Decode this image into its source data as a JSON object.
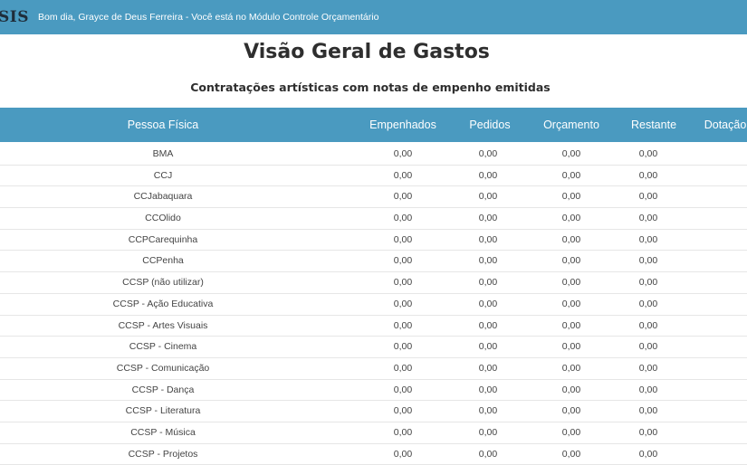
{
  "header": {
    "logo": "SIS",
    "greeting": "Bom dia, Grayce de Deus Ferreira - Você está no Módulo Controle Orçamentário"
  },
  "page": {
    "title": "Visão Geral de Gastos",
    "subtitle": "Contratações artísticas com notas de empenho emitidas"
  },
  "table": {
    "columns": [
      "Pessoa Física",
      "Empenhados",
      "Pedidos",
      "Orçamento",
      "Restante",
      "Dotação"
    ],
    "rows": [
      {
        "name": "BMA",
        "empenhados": "0,00",
        "pedidos": "0,00",
        "orcamento": "0,00",
        "restante": "0,00"
      },
      {
        "name": "CCJ",
        "empenhados": "0,00",
        "pedidos": "0,00",
        "orcamento": "0,00",
        "restante": "0,00"
      },
      {
        "name": "CCJabaquara",
        "empenhados": "0,00",
        "pedidos": "0,00",
        "orcamento": "0,00",
        "restante": "0,00"
      },
      {
        "name": "CCOlido",
        "empenhados": "0,00",
        "pedidos": "0,00",
        "orcamento": "0,00",
        "restante": "0,00"
      },
      {
        "name": "CCPCarequinha",
        "empenhados": "0,00",
        "pedidos": "0,00",
        "orcamento": "0,00",
        "restante": "0,00"
      },
      {
        "name": "CCPenha",
        "empenhados": "0,00",
        "pedidos": "0,00",
        "orcamento": "0,00",
        "restante": "0,00"
      },
      {
        "name": "CCSP (não utilizar)",
        "empenhados": "0,00",
        "pedidos": "0,00",
        "orcamento": "0,00",
        "restante": "0,00"
      },
      {
        "name": "CCSP - Ação Educativa",
        "empenhados": "0,00",
        "pedidos": "0,00",
        "orcamento": "0,00",
        "restante": "0,00"
      },
      {
        "name": "CCSP - Artes Visuais",
        "empenhados": "0,00",
        "pedidos": "0,00",
        "orcamento": "0,00",
        "restante": "0,00"
      },
      {
        "name": "CCSP - Cinema",
        "empenhados": "0,00",
        "pedidos": "0,00",
        "orcamento": "0,00",
        "restante": "0,00"
      },
      {
        "name": "CCSP - Comunicação",
        "empenhados": "0,00",
        "pedidos": "0,00",
        "orcamento": "0,00",
        "restante": "0,00"
      },
      {
        "name": "CCSP - Dança",
        "empenhados": "0,00",
        "pedidos": "0,00",
        "orcamento": "0,00",
        "restante": "0,00"
      },
      {
        "name": "CCSP - Literatura",
        "empenhados": "0,00",
        "pedidos": "0,00",
        "orcamento": "0,00",
        "restante": "0,00"
      },
      {
        "name": "CCSP - Música",
        "empenhados": "0,00",
        "pedidos": "0,00",
        "orcamento": "0,00",
        "restante": "0,00"
      },
      {
        "name": "CCSP - Projetos",
        "empenhados": "0,00",
        "pedidos": "0,00",
        "orcamento": "0,00",
        "restante": "0,00"
      }
    ]
  },
  "colors": {
    "header_bg": "#4a9ac0",
    "row_border": "#e6e6e6"
  }
}
